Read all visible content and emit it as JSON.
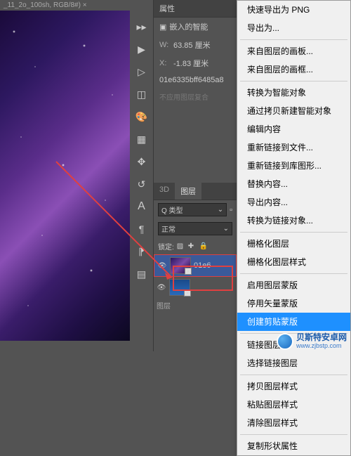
{
  "tab": {
    "title": "_11_2o_100sh, RGB/8#)"
  },
  "properties": {
    "header": "属性",
    "embedded": "嵌入的智能",
    "w_lbl": "W:",
    "w_val": "63.85 厘米",
    "x_lbl": "X:",
    "x_val": "-1.83 厘米",
    "id": "01e6335bff6485a8",
    "compose_hint": "不应用图层复合"
  },
  "layers": {
    "tab_3d": "3D",
    "tab_layers": "图层",
    "kind_lbl": "Q 类型",
    "blend_mode": "正常",
    "lock_lbl": "锁定:",
    "layer1_name": "01e6",
    "footer_lbl": "图层"
  },
  "menu": {
    "items": [
      "快速导出为 PNG",
      "导出为...",
      "---",
      "来自图层的画板...",
      "来自图层的画框...",
      "---",
      "转换为智能对象",
      "通过拷贝新建智能对象",
      "编辑内容",
      "重新链接到文件...",
      "重新链接到库图形...",
      "替换内容...",
      "导出内容...",
      "转换为链接对象...",
      "---",
      "栅格化图层",
      "栅格化图层样式",
      "---",
      "启用图层蒙版",
      "停用矢量蒙版",
      "创建剪贴蒙版",
      "---",
      "链接图层",
      "选择链接图层",
      "---",
      "拷贝图层样式",
      "粘贴图层样式",
      "清除图层样式",
      "---",
      "复制形状属性"
    ],
    "highlight": "创建剪贴蒙版"
  },
  "watermark": {
    "zh": "贝斯特安卓网",
    "en": "www.zjbstp.com"
  }
}
